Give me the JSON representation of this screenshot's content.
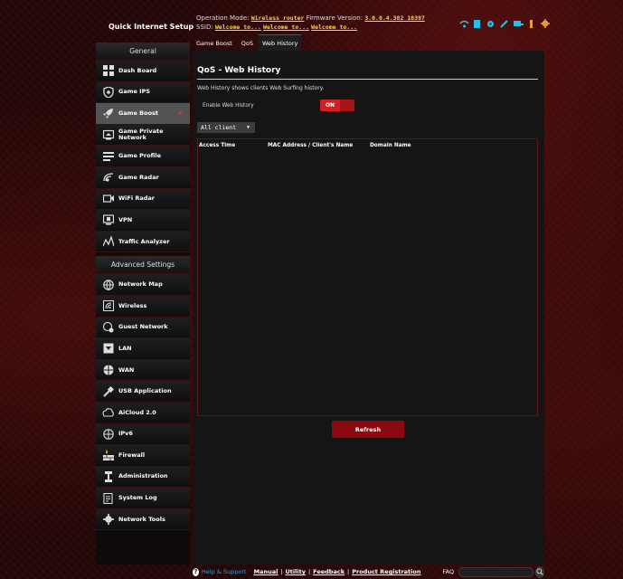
{
  "top": {
    "quick_setup": "Quick Internet Setup",
    "operation_mode_label": "Operation Mode:",
    "operation_mode_value": "Wireless router",
    "firmware_label": "Firmware Version:",
    "firmware_value": "3.0.0.4.382_10397",
    "ssid_label": "SSID:",
    "ssid_values": [
      "Welcome to...",
      "Welcome to...",
      "Welcome to..."
    ]
  },
  "tabs": [
    {
      "label": "Game Boost"
    },
    {
      "label": "QoS"
    },
    {
      "label": "Web History"
    }
  ],
  "sidebar": {
    "general_label": "General",
    "advanced_label": "Advanced Settings",
    "general_items": [
      {
        "label": "Dash Board",
        "icon": "dashboard-icon"
      },
      {
        "label": "Game IPS",
        "icon": "shield-icon"
      },
      {
        "label": "Game Boost",
        "icon": "rocket-icon"
      },
      {
        "label": "Game Private Network",
        "icon": "monitor-icon"
      },
      {
        "label": "Game Profile",
        "icon": "profile-icon"
      },
      {
        "label": "Game Radar",
        "icon": "radar-icon"
      },
      {
        "label": "WiFi Radar",
        "icon": "wifi-radar-icon"
      },
      {
        "label": "VPN",
        "icon": "vpn-icon"
      },
      {
        "label": "Traffic Analyzer",
        "icon": "traffic-icon"
      }
    ],
    "advanced_items": [
      {
        "label": "Network Map",
        "icon": "globe-icon"
      },
      {
        "label": "Wireless",
        "icon": "wireless-icon"
      },
      {
        "label": "Guest Network",
        "icon": "guest-icon"
      },
      {
        "label": "LAN",
        "icon": "lan-icon"
      },
      {
        "label": "WAN",
        "icon": "wan-icon"
      },
      {
        "label": "USB Application",
        "icon": "usb-icon"
      },
      {
        "label": "AiCloud 2.0",
        "icon": "cloud-icon"
      },
      {
        "label": "IPv6",
        "icon": "ipv6-icon"
      },
      {
        "label": "Firewall",
        "icon": "firewall-icon"
      },
      {
        "label": "Administration",
        "icon": "admin-icon"
      },
      {
        "label": "System Log",
        "icon": "log-icon"
      },
      {
        "label": "Network Tools",
        "icon": "tools-icon"
      }
    ]
  },
  "main": {
    "title": "QoS - Web History",
    "description": "Web History shows clients Web Surfing history.",
    "enable_label": "Enable Web History",
    "toggle_on": "ON",
    "client_select": "All client",
    "columns": [
      "Access Time",
      "MAC Address / Client's Name",
      "Domain Name"
    ],
    "refresh": "Refresh"
  },
  "footer": {
    "help": "Help & Support",
    "links": [
      "Manual",
      "Utility",
      "Feedback",
      "Product Registration"
    ],
    "faq": "FAQ"
  },
  "colors": {
    "accent_red": "#d11f24",
    "link_yellow": "#fcd53f",
    "help_blue": "#2f9fe0"
  }
}
